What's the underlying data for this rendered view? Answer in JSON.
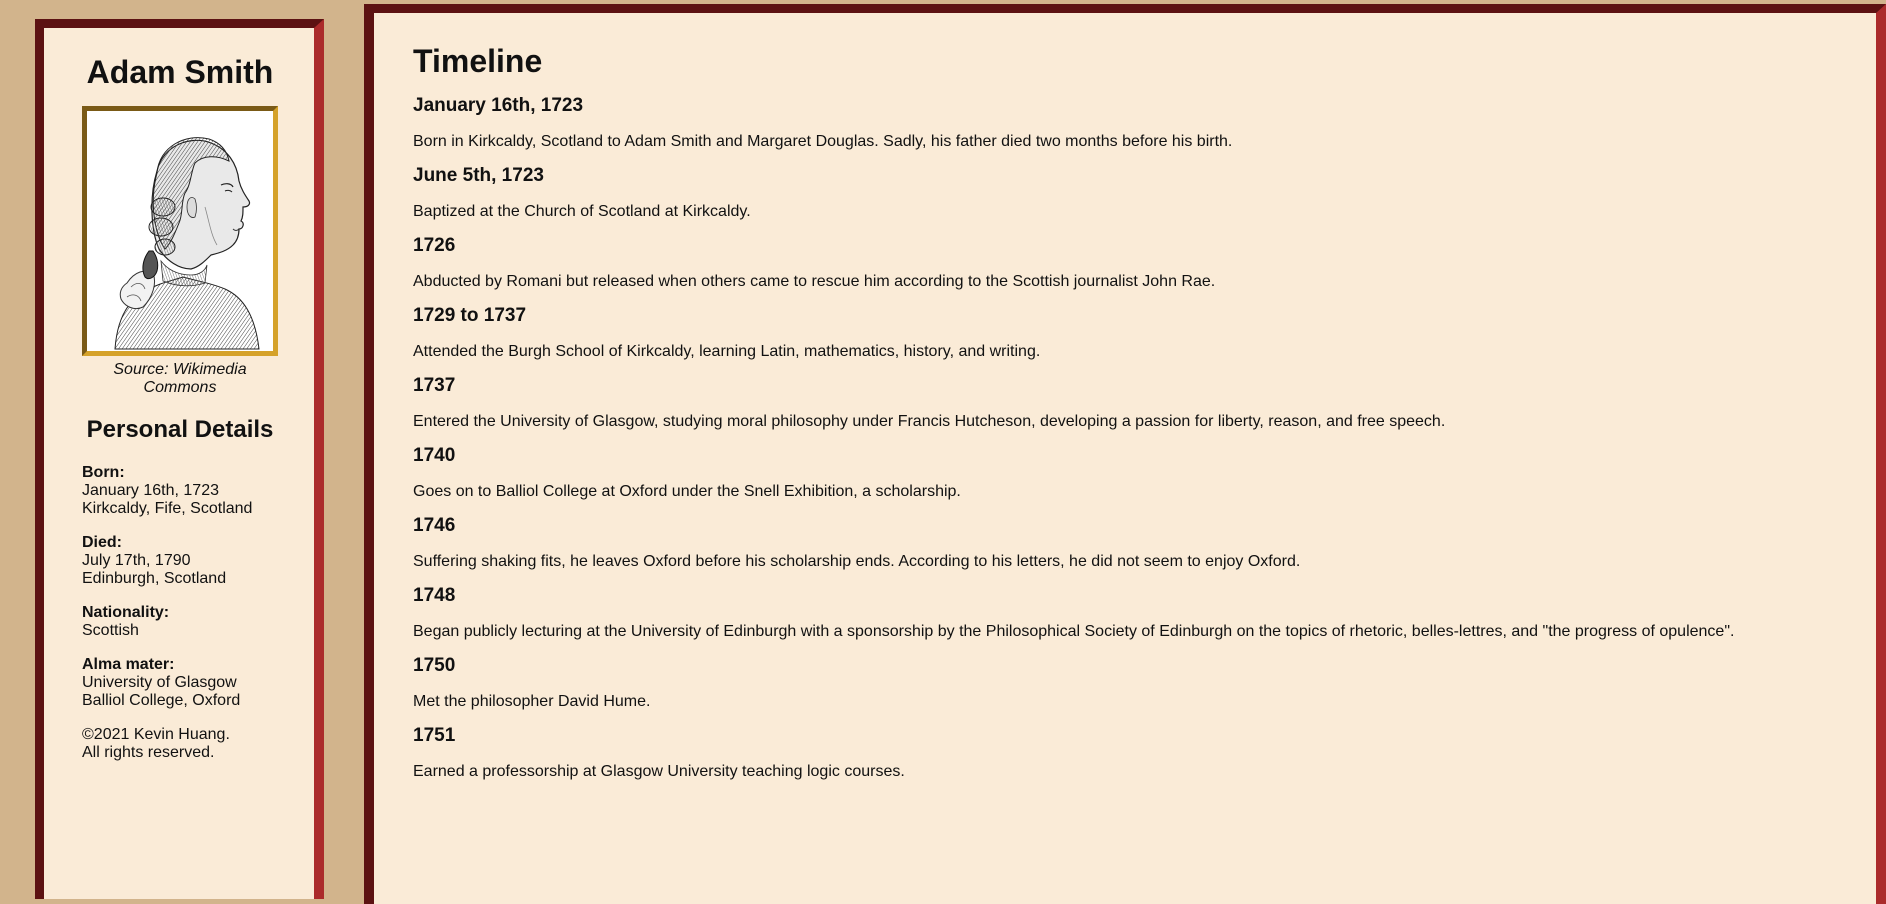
{
  "sidebar": {
    "name": "Adam Smith",
    "portrait_alt": "Portrait of Adam Smith",
    "caption_line1": "Source: Wikimedia",
    "caption_line2": "Commons",
    "details_title": "Personal Details",
    "born_label": "Born:",
    "born_date": "January 16th, 1723",
    "born_place": "Kirkcaldy, Fife, Scotland",
    "died_label": "Died:",
    "died_date": "July 17th, 1790",
    "died_place": "Edinburgh, Scotland",
    "nationality_label": "Nationality:",
    "nationality_value": "Scottish",
    "alma_label": "Alma mater:",
    "alma_1": "University of Glasgow",
    "alma_2": "Balliol College, Oxford",
    "copyright_1": "©2021 Kevin Huang.",
    "copyright_2": "All rights reserved."
  },
  "main": {
    "title": "Timeline",
    "entries": [
      {
        "date": "January 16th, 1723",
        "text": "Born in Kirkcaldy, Scotland to Adam Smith and Margaret Douglas. Sadly, his father died two months before his birth."
      },
      {
        "date": "June 5th, 1723",
        "text": "Baptized at the Church of Scotland at Kirkcaldy."
      },
      {
        "date": "1726",
        "text": "Abducted by Romani but released when others came to rescue him according to the Scottish journalist John Rae."
      },
      {
        "date": "1729 to 1737",
        "text": "Attended the Burgh School of Kirkcaldy, learning Latin, mathematics, history, and writing."
      },
      {
        "date": "1737",
        "text": "Entered the University of Glasgow, studying moral philosophy under Francis Hutcheson, developing a passion for liberty, reason, and free speech."
      },
      {
        "date": "1740",
        "text": "Goes on to Balliol College at Oxford under the Snell Exhibition, a scholarship."
      },
      {
        "date": "1746",
        "text": "Suffering shaking fits, he leaves Oxford before his scholarship ends. According to his letters, he did not seem to enjoy Oxford."
      },
      {
        "date": "1748",
        "text": "Began publicly lecturing at the University of Edinburgh with a sponsorship by the Philosophical Society of Edinburgh on the topics of rhetoric, belles-lettres, and \"the progress of opulence\"."
      },
      {
        "date": "1750",
        "text": "Met the philosopher David Hume."
      },
      {
        "date": "1751",
        "text": "Earned a professorship at Glasgow University teaching logic courses."
      }
    ]
  },
  "colors": {
    "page_background": "#d2b48c",
    "panel_background": "#faebd7",
    "border_dark": "#5c1212",
    "border_red": "#ab2b2b",
    "frame_gold": "#d5a22a"
  }
}
